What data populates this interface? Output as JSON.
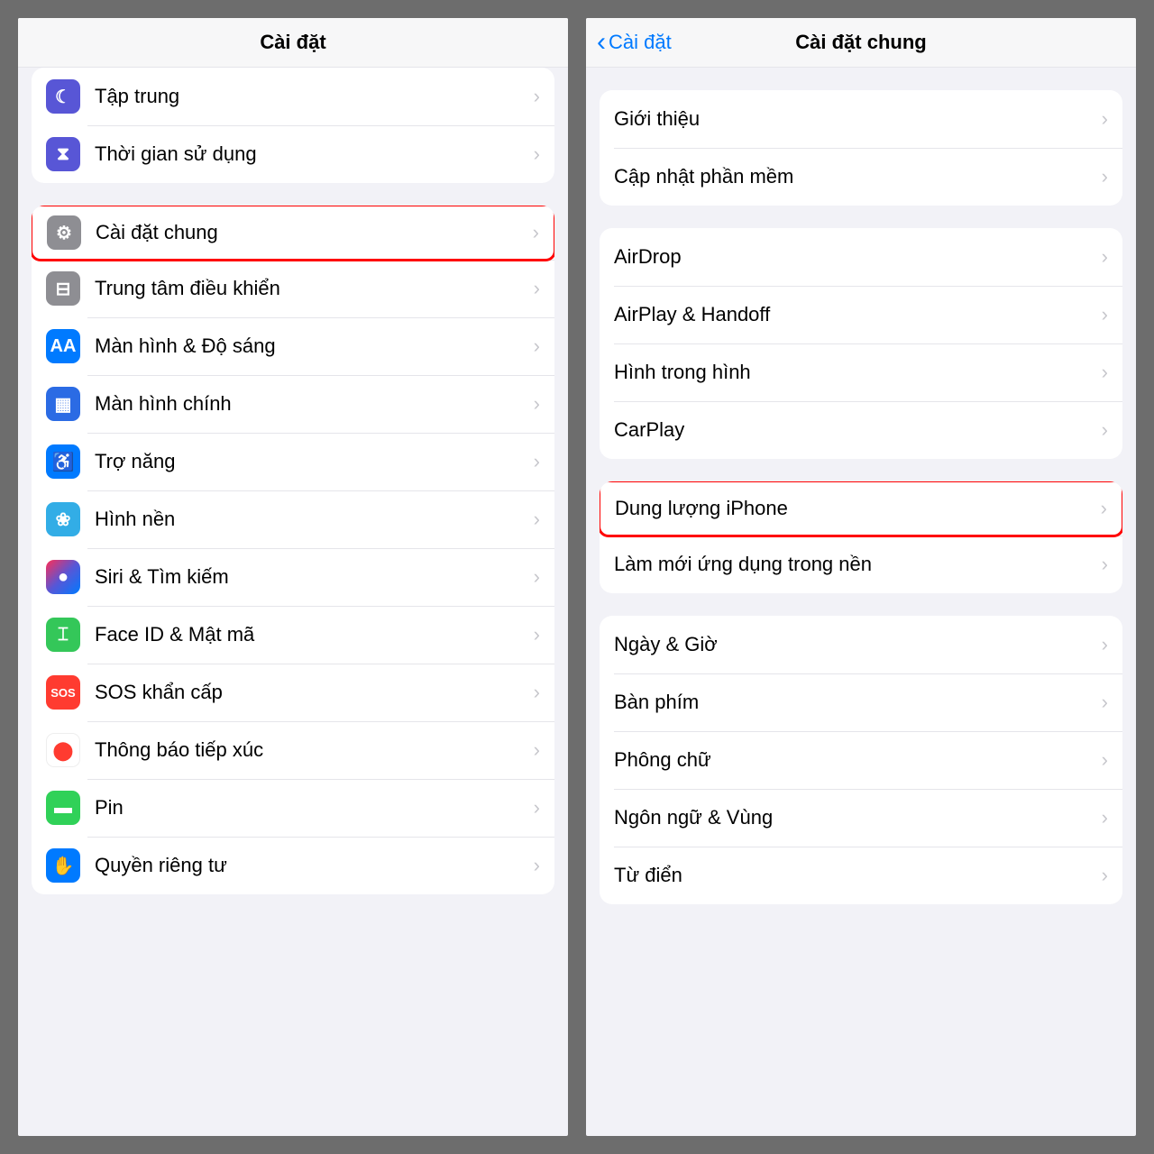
{
  "left": {
    "title": "Cài đặt",
    "groups": [
      {
        "tightTop": true,
        "itop": true,
        "rows": [
          {
            "label": "Tập trung",
            "icon": "focus-icon",
            "iconClass": "bg-purple",
            "glyph": "☾"
          },
          {
            "label": "Thời gian sử dụng",
            "icon": "screentime-icon",
            "iconClass": "bg-purple",
            "glyph": "⧗"
          }
        ]
      },
      {
        "rows": [
          {
            "label": "Cài đặt chung",
            "icon": "general-icon",
            "iconClass": "bg-gray",
            "glyph": "⚙",
            "highlighted": true
          },
          {
            "label": "Trung tâm điều khiển",
            "icon": "control-center-icon",
            "iconClass": "bg-gray",
            "glyph": "⊟"
          },
          {
            "label": "Màn hình & Độ sáng",
            "icon": "display-icon",
            "iconClass": "bg-blue",
            "glyph": "AA"
          },
          {
            "label": "Màn hình chính",
            "icon": "home-screen-icon",
            "iconClass": "bg-apps",
            "glyph": "▦"
          },
          {
            "label": "Trợ năng",
            "icon": "accessibility-icon",
            "iconClass": "bg-blue",
            "glyph": "♿"
          },
          {
            "label": "Hình nền",
            "icon": "wallpaper-icon",
            "iconClass": "bg-cyan",
            "glyph": "❀"
          },
          {
            "label": "Siri & Tìm kiếm",
            "icon": "siri-icon",
            "iconClass": "bg-siri",
            "glyph": "●"
          },
          {
            "label": "Face ID & Mật mã",
            "icon": "faceid-icon",
            "iconClass": "bg-green",
            "glyph": "⌶"
          },
          {
            "label": "SOS khẩn cấp",
            "icon": "sos-icon",
            "iconClass": "bg-red",
            "glyph": "SOS",
            "small": true
          },
          {
            "label": "Thông báo tiếp xúc",
            "icon": "exposure-icon",
            "iconClass": "bg-dotred",
            "glyph": "⬤",
            "glyphColor": "#ff3b30"
          },
          {
            "label": "Pin",
            "icon": "battery-icon",
            "iconClass": "bg-green2",
            "glyph": "▬"
          },
          {
            "label": "Quyền riêng tư",
            "icon": "privacy-icon",
            "iconClass": "bg-blue",
            "glyph": "✋"
          }
        ]
      }
    ]
  },
  "right": {
    "backLabel": "Cài đặt",
    "title": "Cài đặt chung",
    "groups": [
      {
        "rows": [
          {
            "label": "Giới thiệu"
          },
          {
            "label": "Cập nhật phần mềm"
          }
        ]
      },
      {
        "rows": [
          {
            "label": "AirDrop"
          },
          {
            "label": "AirPlay & Handoff"
          },
          {
            "label": "Hình trong hình"
          },
          {
            "label": "CarPlay"
          }
        ]
      },
      {
        "rows": [
          {
            "label": "Dung lượng iPhone",
            "highlighted": true
          },
          {
            "label": "Làm mới ứng dụng trong nền"
          }
        ]
      },
      {
        "rows": [
          {
            "label": "Ngày & Giờ"
          },
          {
            "label": "Bàn phím"
          },
          {
            "label": "Phông chữ"
          },
          {
            "label": "Ngôn ngữ & Vùng"
          },
          {
            "label": "Từ điển"
          }
        ]
      }
    ]
  }
}
